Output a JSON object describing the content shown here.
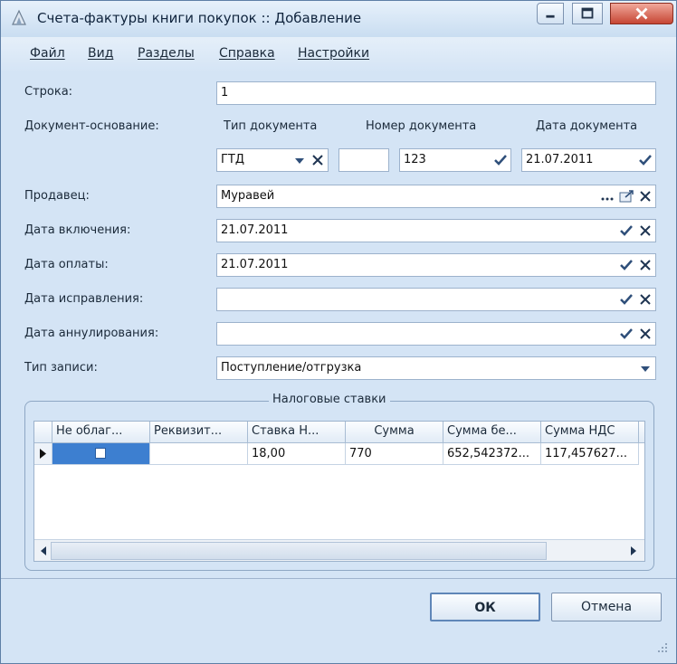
{
  "window": {
    "title": "Счета-фактуры книги покупок :: Добавление"
  },
  "menu": [
    {
      "label": "Файл"
    },
    {
      "label": "Вид"
    },
    {
      "label": "Разделы"
    },
    {
      "label": "Справка"
    },
    {
      "label": "Настройки"
    }
  ],
  "form": {
    "row_label": "Строка:",
    "row_value": "1",
    "basis_label": "Документ-основание:",
    "doc_type_header": "Тип документа",
    "doc_number_header": "Номер документа",
    "doc_date_header": "Дата документа",
    "doc_type_value": "ГТД",
    "doc_number_prefix": "",
    "doc_number_value": "123",
    "doc_date_value": "21.07.2011",
    "seller_label": "Продавец:",
    "seller_value": "Муравей",
    "inclusion_date_label": "Дата включения:",
    "inclusion_date_value": "21.07.2011",
    "payment_date_label": "Дата оплаты:",
    "payment_date_value": "21.07.2011",
    "correction_date_label": "Дата исправления:",
    "correction_date_value": "",
    "annulment_date_label": "Дата аннулирования:",
    "annulment_date_value": "",
    "record_type_label": "Тип записи:",
    "record_type_value": "Поступление/отгрузка"
  },
  "tax_rates": {
    "group_title": "Налоговые ставки",
    "columns": [
      "Не облаг...",
      "Реквизит...",
      "Ставка Н...",
      "Сумма",
      "Сумма бе...",
      "Сумма НДС"
    ],
    "rows": [
      {
        "not_taxed": false,
        "requisite": "",
        "rate": "18,00",
        "sum": "770",
        "sum_without": "652,542372...",
        "vat_sum": "117,457627..."
      }
    ]
  },
  "buttons": {
    "ok": "ОК",
    "cancel": "Отмена"
  },
  "colors": {
    "accent": "#3d7fd0",
    "close": "#c64634",
    "check": "#2f4f7a"
  }
}
